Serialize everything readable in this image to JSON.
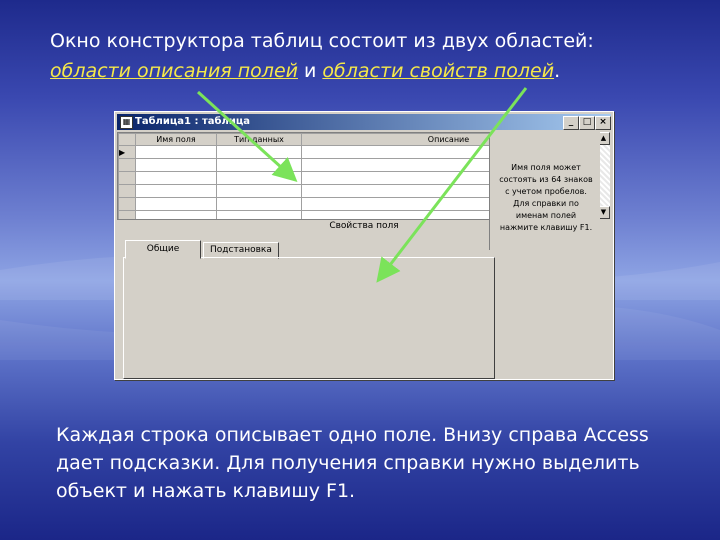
{
  "heading": {
    "line1": "Окно конструктора таблиц состоит из двух областей:",
    "part1": "области описания полей",
    "mid": " и ",
    "part2": "области свойств полей",
    "end": "."
  },
  "window": {
    "title": "Таблица1 : таблица",
    "minimize": "_",
    "maximize": "□",
    "close": "×",
    "columns": [
      "Имя поля",
      "Тип данных",
      "Описание"
    ],
    "row_marker": "▶",
    "props_label": "Свойства поля",
    "tabs": [
      "Общие",
      "Подстановка"
    ],
    "hint": "Имя поля может состоять из 64 знаков с учетом пробелов. Для справки по именам полей нажмите клавишу F1."
  },
  "bottom_text": "Каждая строка описывает одно поле. Внизу справа Access дает подсказки. Для получения справки нужно выделить объект и нажать клавишу F1.",
  "colors": {
    "background_top": "#1e2a8c",
    "highlight": "#f5e84a",
    "arrow": "#7be35a"
  }
}
